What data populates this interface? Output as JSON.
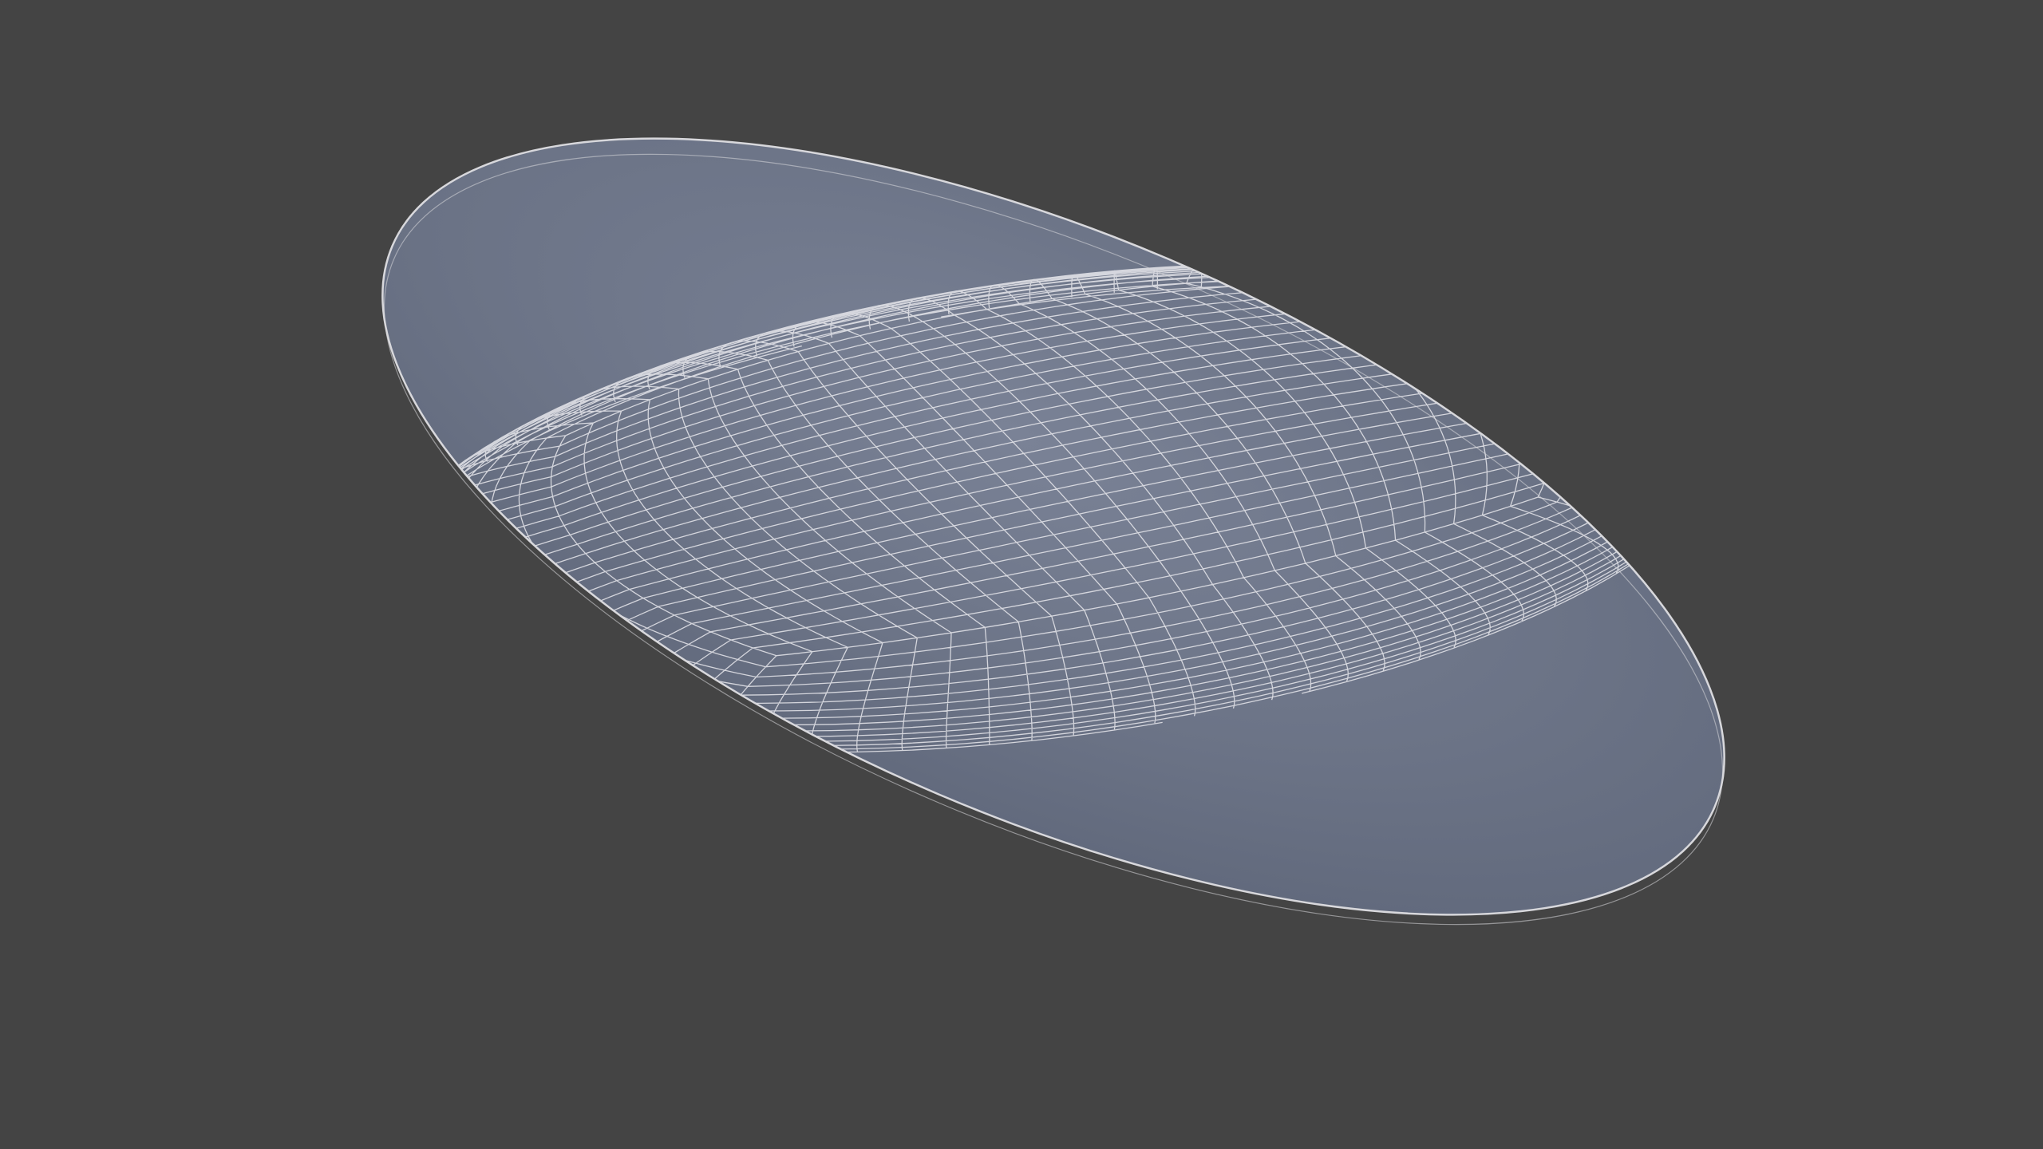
{
  "viewport": {
    "background_color": "#444444"
  },
  "mesh": {
    "shape": "flattened-ellipsoid",
    "topology": "quad-sphere",
    "fill_color": "#6b7386",
    "highlight_color": "#7a8296",
    "shadow_color": "#5f677a",
    "wire_color": "#e8e8ec",
    "outline_color": "#d8d8dc"
  }
}
